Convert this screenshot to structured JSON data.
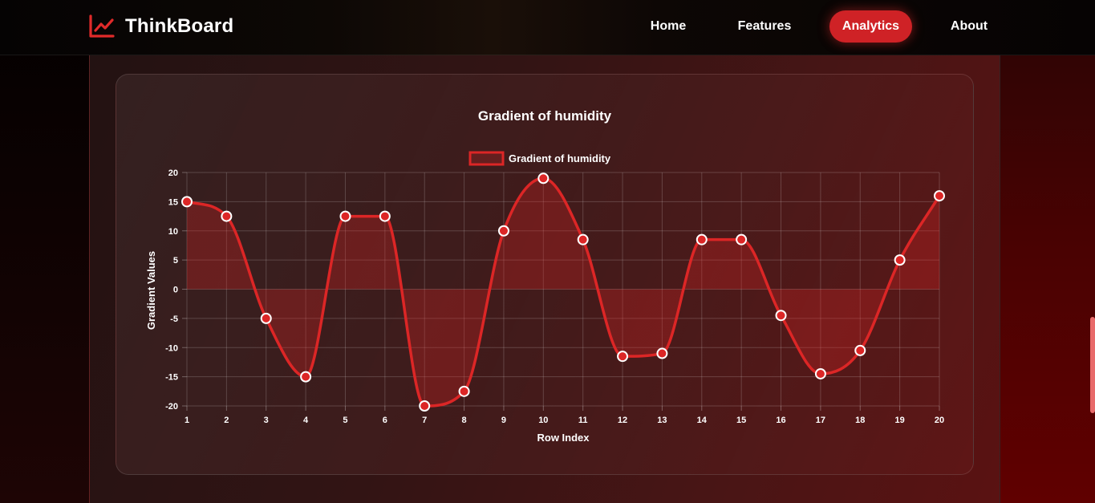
{
  "header": {
    "brand": "ThinkBoard",
    "brand_icon": "trend-chart-icon",
    "nav": [
      {
        "label": "Home",
        "active": false
      },
      {
        "label": "Features",
        "active": false
      },
      {
        "label": "Analytics",
        "active": true
      },
      {
        "label": "About",
        "active": false
      }
    ]
  },
  "colors": {
    "accent": "#cf2226",
    "line": "#dc2626",
    "point_fill": "#dc2626",
    "point_stroke": "#ffffff"
  },
  "chart_data": {
    "type": "line",
    "title": "Gradient of humidity",
    "xlabel": "Row Index",
    "ylabel": "Gradient Values",
    "legend_position": "top",
    "grid": true,
    "x": [
      1,
      2,
      3,
      4,
      5,
      6,
      7,
      8,
      9,
      10,
      11,
      12,
      13,
      14,
      15,
      16,
      17,
      18,
      19,
      20
    ],
    "ylim": [
      -20,
      20
    ],
    "yticks": [
      20,
      15,
      10,
      5,
      0,
      -5,
      -10,
      -15,
      -20
    ],
    "series": [
      {
        "name": "Gradient of humidity",
        "fill_to_zero": true,
        "values": [
          15,
          12.5,
          -5,
          -15,
          12.5,
          12.5,
          -20,
          -17.5,
          10,
          19,
          8.5,
          -11.5,
          -11,
          8.5,
          8.5,
          -4.5,
          -14.5,
          -10.5,
          5,
          16
        ]
      }
    ]
  }
}
